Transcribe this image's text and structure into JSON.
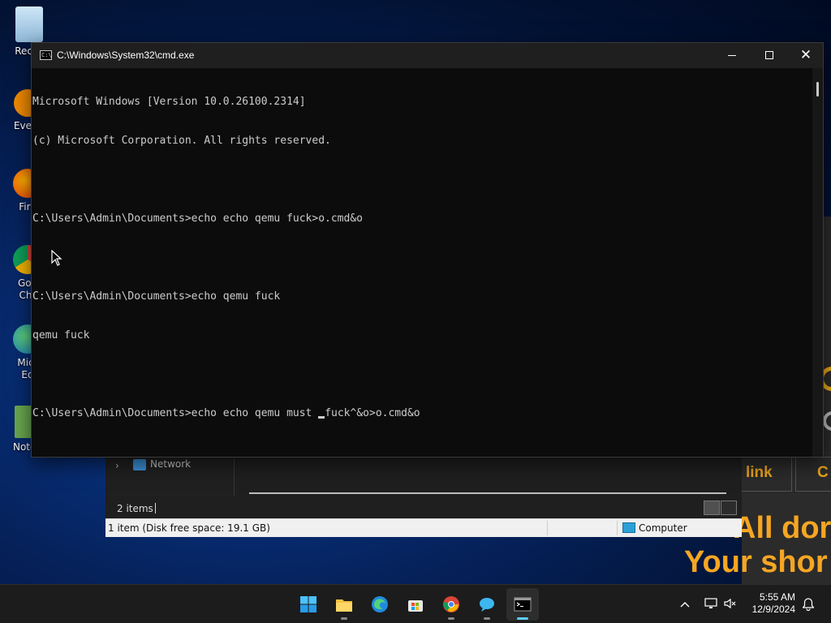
{
  "desktop": {
    "icons": [
      {
        "label": "Recyc",
        "icon": "recycle-bin-icon"
      },
      {
        "label": "Every",
        "icon": "everything-search-icon"
      },
      {
        "label": "Fire",
        "icon": "firefox-icon"
      },
      {
        "label": "Goo Chr",
        "icon": "chrome-icon"
      },
      {
        "label": "Micr Ed",
        "icon": "edge-icon"
      },
      {
        "label": "Notep",
        "icon": "notepad-icon"
      }
    ]
  },
  "explorer": {
    "nav_item": "Network",
    "item_count": "2 items",
    "disk_info": "1 item (Disk free space: 19.1 GB)",
    "location": "Computer"
  },
  "webpage": {
    "button_link": "link",
    "button_c": "C",
    "promo_line1": "All dor",
    "promo_line2": "Your shor",
    "accent": "#f5a623"
  },
  "cmd": {
    "title": "C:\\Windows\\System32\\cmd.exe",
    "lines": [
      "Microsoft Windows [Version 10.0.26100.2314]",
      "(c) Microsoft Corporation. All rights reserved.",
      "",
      "C:\\Users\\Admin\\Documents>echo echo qemu fuck>o.cmd&o",
      "",
      "C:\\Users\\Admin\\Documents>echo qemu fuck",
      "qemu fuck",
      "",
      "C:\\Users\\Admin\\Documents>echo echo qemu must "
    ],
    "current_input_after_cursor": "fuck^&o>o.cmd&o",
    "colors": {
      "background": "#0c0c0c",
      "text": "#cccccc"
    }
  },
  "taskbar": {
    "apps": [
      {
        "name": "start",
        "icon": "windows-start-icon"
      },
      {
        "name": "file-explorer",
        "icon": "file-explorer-icon"
      },
      {
        "name": "edge",
        "icon": "edge-icon"
      },
      {
        "name": "store",
        "icon": "microsoft-store-icon"
      },
      {
        "name": "chrome",
        "icon": "chrome-icon"
      },
      {
        "name": "copilot",
        "icon": "copilot-icon"
      },
      {
        "name": "terminal",
        "icon": "terminal-icon"
      }
    ],
    "time": "5:55 AM",
    "date": "12/9/2024"
  }
}
